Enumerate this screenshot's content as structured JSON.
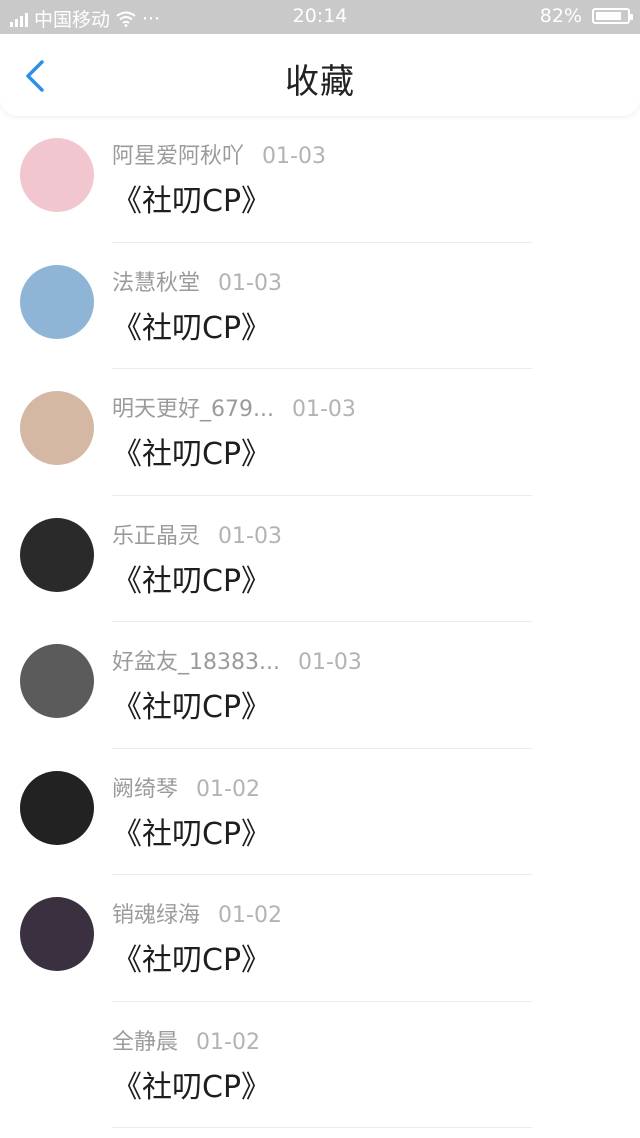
{
  "status_bar": {
    "carrier": "中国移动",
    "dots": "···",
    "time": "20:14",
    "battery_text": "82%",
    "battery_level": 0.82
  },
  "header": {
    "title": "收藏",
    "back_icon": "chevron-left-icon",
    "accent_color": "#2f8fe6"
  },
  "items": [
    {
      "name": "阿星爱阿秋吖",
      "date": "01-03",
      "subject": "《社叨CP》",
      "avatar_color": "#f1c6cf"
    },
    {
      "name": "法慧秋堂",
      "date": "01-03",
      "subject": "《社叨CP》",
      "avatar_color": "#8fb5d6"
    },
    {
      "name": "明天更好_679...",
      "date": "01-03",
      "subject": "《社叨CP》",
      "avatar_color": "#d4b8a4"
    },
    {
      "name": "乐正晶灵",
      "date": "01-03",
      "subject": "《社叨CP》",
      "avatar_color": "#2a2a2a"
    },
    {
      "name": "好盆友_18383...",
      "date": "01-03",
      "subject": "《社叨CP》",
      "avatar_color": "#5b5b5b"
    },
    {
      "name": "阙绮琴",
      "date": "01-02",
      "subject": "《社叨CP》",
      "avatar_color": "#222222"
    },
    {
      "name": "销魂绿海",
      "date": "01-02",
      "subject": "《社叨CP》",
      "avatar_color": "#3b3040"
    },
    {
      "name": "全静晨",
      "date": "01-02",
      "subject": "《社叨CP》",
      "avatar_color": ""
    }
  ]
}
